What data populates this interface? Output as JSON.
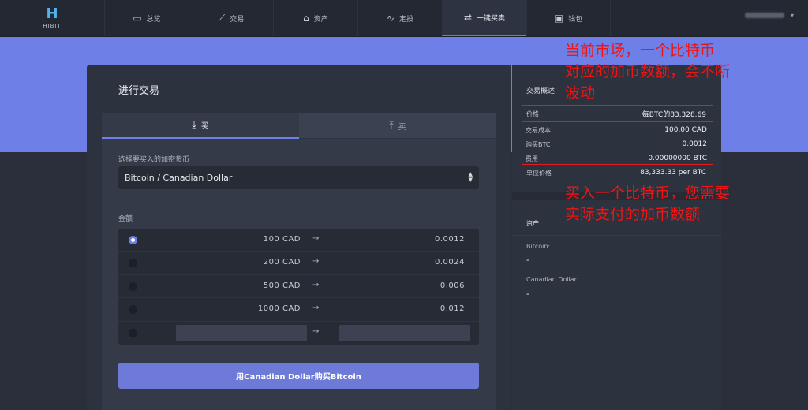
{
  "brand": {
    "mark": "H",
    "name": "HIBIT"
  },
  "nav": [
    {
      "label": "总览",
      "icon": "dashboard-icon",
      "glyph": "▭"
    },
    {
      "label": "交易",
      "icon": "chart-line-icon",
      "glyph": "⟋"
    },
    {
      "label": "资产",
      "icon": "bank-icon",
      "glyph": "⌂"
    },
    {
      "label": "定投",
      "icon": "pulse-icon",
      "glyph": "∿"
    },
    {
      "label": "一键买卖",
      "icon": "swap-icon",
      "glyph": "⇄"
    },
    {
      "label": "钱包",
      "icon": "wallet-icon",
      "glyph": "▣"
    }
  ],
  "user": {
    "dropdown_glyph": "▾"
  },
  "trade": {
    "title": "进行交易",
    "tab_buy": "买",
    "tab_sell": "卖",
    "select_label": "选择要买入的加密货币",
    "select_value": "Bitcoin / Canadian Dollar",
    "amount_label": "金额",
    "rows": [
      {
        "cad": "100 CAD",
        "btc": "0.0012",
        "selected": true
      },
      {
        "cad": "200 CAD",
        "btc": "0.0024",
        "selected": false
      },
      {
        "cad": "500 CAD",
        "btc": "0.006",
        "selected": false
      },
      {
        "cad": "1000 CAD",
        "btc": "0.012",
        "selected": false
      }
    ],
    "arrow": "→",
    "submit_label": "用Canadian Dollar购买Bitcoin"
  },
  "summary": {
    "title": "交易概述",
    "price_label": "价格",
    "price_value": "每BTC的83,328.69",
    "cost_label": "交易成本",
    "cost_value": "100.00 CAD",
    "buy_label": "购买BTC",
    "buy_value": "0.0012",
    "fee_label": "费用",
    "fee_value": "0.00000000 BTC",
    "unit_label": "单位价格",
    "unit_value": "83,333.33 per BTC"
  },
  "assets": {
    "title": "资产",
    "bitcoin_label": "Bitcoin:",
    "bitcoin_value": "-",
    "cad_label": "Canadian Dollar:",
    "cad_value": "-"
  },
  "annotations": {
    "top_line1": "当前市场，一个比特币",
    "top_line2": "对应的加币数额，会不断",
    "top_line3": "波动",
    "bottom_line1": "买入一个比特币，您需要",
    "bottom_line2": "实际支付的加币数额"
  },
  "colors": {
    "accent": "#6e80e8",
    "annotation": "#f01414",
    "background": "#2a2f3b"
  }
}
